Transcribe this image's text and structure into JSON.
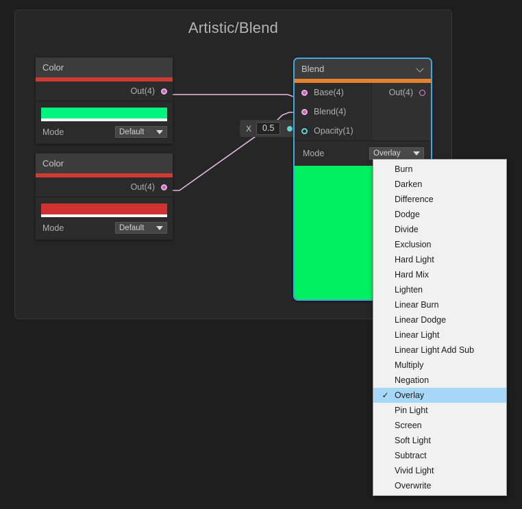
{
  "group": {
    "title": "Artistic/Blend"
  },
  "nodes": {
    "color_a": {
      "title": "Color",
      "out_port_label": "Out(4)",
      "swatch_color": "#00f57f",
      "mode_label": "Mode",
      "mode_value": "Default"
    },
    "color_b": {
      "title": "Color",
      "out_port_label": "Out(4)",
      "swatch_color": "#cf3230",
      "mode_label": "Mode",
      "mode_value": "Default"
    },
    "x_slider": {
      "label": "X",
      "value": "0.5"
    },
    "blend": {
      "title": "Blend",
      "inputs": [
        {
          "label": "Base(4)",
          "type": "vector4"
        },
        {
          "label": "Blend(4)",
          "type": "vector4"
        },
        {
          "label": "Opacity(1)",
          "type": "float"
        }
      ],
      "output": {
        "label": "Out(4)",
        "type": "vector4"
      },
      "mode_label": "Mode",
      "mode_value": "Overlay",
      "preview_color": "#00f060"
    }
  },
  "mode_menu": {
    "selected": "Overlay",
    "check_glyph": "✓",
    "items": [
      "Burn",
      "Darken",
      "Difference",
      "Dodge",
      "Divide",
      "Exclusion",
      "Hard Light",
      "Hard Mix",
      "Lighten",
      "Linear Burn",
      "Linear Dodge",
      "Linear Light",
      "Linear Light Add Sub",
      "Multiply",
      "Negation",
      "Overlay",
      "Pin Light",
      "Screen",
      "Soft Light",
      "Subtract",
      "Vivid Light",
      "Overwrite"
    ]
  },
  "colors": {
    "accent_selected": "#3fa9e8",
    "accent_node_color": "#cf3a33",
    "accent_node_blend": "#e3822f",
    "wire_vector": "#e5b9e0",
    "wire_float": "#5fd6d6",
    "canvas_bg": "#1e1e1e",
    "menu_highlight": "#a8d8f8"
  }
}
